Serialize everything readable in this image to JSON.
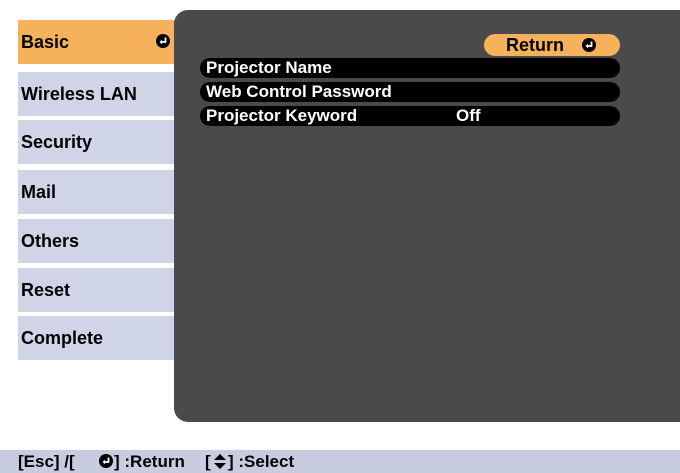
{
  "menu": {
    "items": [
      {
        "label": "Basic",
        "selected": true
      },
      {
        "label": "Wireless LAN",
        "selected": false
      },
      {
        "label": "Security",
        "selected": false
      },
      {
        "label": "Mail",
        "selected": false
      },
      {
        "label": "Others",
        "selected": false
      },
      {
        "label": "Reset",
        "selected": false
      },
      {
        "label": "Complete",
        "selected": false
      }
    ],
    "enter_icon": "enter-icon"
  },
  "panel": {
    "return_label": "Return",
    "rows": [
      {
        "name": "Projector Name",
        "value": ""
      },
      {
        "name": "Web Control Password",
        "value": ""
      },
      {
        "name": "Projector Keyword",
        "value": "Off"
      }
    ]
  },
  "footer": {
    "esc_hint": "[Esc] /[",
    "return_hint": "] :Return",
    "select_hint": "[",
    "select_label": "] :Select",
    "icons": [
      "enter-icon",
      "up-down-arrow-icon"
    ]
  },
  "colors": {
    "selected": "#f5b25a",
    "menu_item": "#cfd4e6",
    "panel": "#4a4a4a",
    "footer": "#c7cce0"
  }
}
